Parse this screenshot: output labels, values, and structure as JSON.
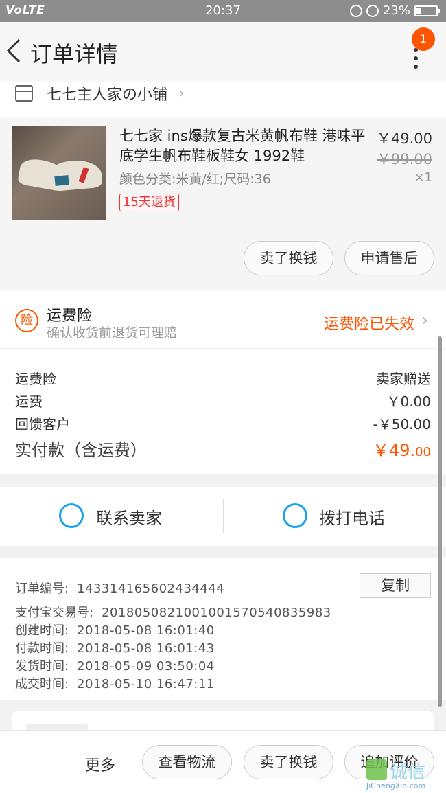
{
  "status_bar": {
    "network": "VoLTE",
    "time": "20:37",
    "battery": "23%"
  },
  "nav": {
    "title": "订单详情",
    "badge_count": "1"
  },
  "shop": {
    "name": "七七主人家の小铺"
  },
  "item": {
    "name": "七七家 ins爆款复古米黄帆布鞋 港味平底学生帆布鞋板鞋女 1992鞋",
    "sku": "颜色分类:米黄/红;尺码:36",
    "tag": "15天退货",
    "price": "￥49.00",
    "original_price": "￥99.00",
    "quantity": "×1",
    "sell_label": "卖了换钱",
    "after_sale_label": "申请售后"
  },
  "insurance": {
    "icon_text": "险",
    "title": "运费险",
    "subtitle": "确认收货前退货可理赔",
    "status": "运费险已失效"
  },
  "fees": [
    {
      "label": "运费险",
      "value": "卖家赠送"
    },
    {
      "label": "运费",
      "value": "￥0.00"
    },
    {
      "label": "回馈客户",
      "value": "-￥50.00"
    }
  ],
  "total": {
    "label": "实付款（含运费）",
    "value_main": "￥49.",
    "value_cents": "00"
  },
  "contact": {
    "seller_label": "联系卖家",
    "phone_label": "拨打电话"
  },
  "order_info": {
    "copy_label": "复制",
    "rows": [
      {
        "key": "订单编号:",
        "value": "143314165602434444"
      },
      {
        "key": "支付宝交易号:",
        "value": "2018050821001001570540835983"
      },
      {
        "key": "创建时间:",
        "value": "2018-05-08 16:01:40"
      },
      {
        "key": "付款时间:",
        "value": "2018-05-08 16:01:43"
      },
      {
        "key": "发货时间:",
        "value": "2018-05-09 03:50:04"
      },
      {
        "key": "成交时间:",
        "value": "2018-05-10 16:47:11"
      }
    ]
  },
  "bottom_bar": {
    "more_label": "更多",
    "logistics_label": "查看物流",
    "sell_label": "卖了换钱",
    "review_label": "追加评价"
  },
  "watermark": {
    "text": "诚信",
    "url": "JiChengXin.com"
  },
  "colors": {
    "accent": "#ff5500",
    "link_blue": "#1aa3ec",
    "status_bar": "#8d8d8d"
  }
}
